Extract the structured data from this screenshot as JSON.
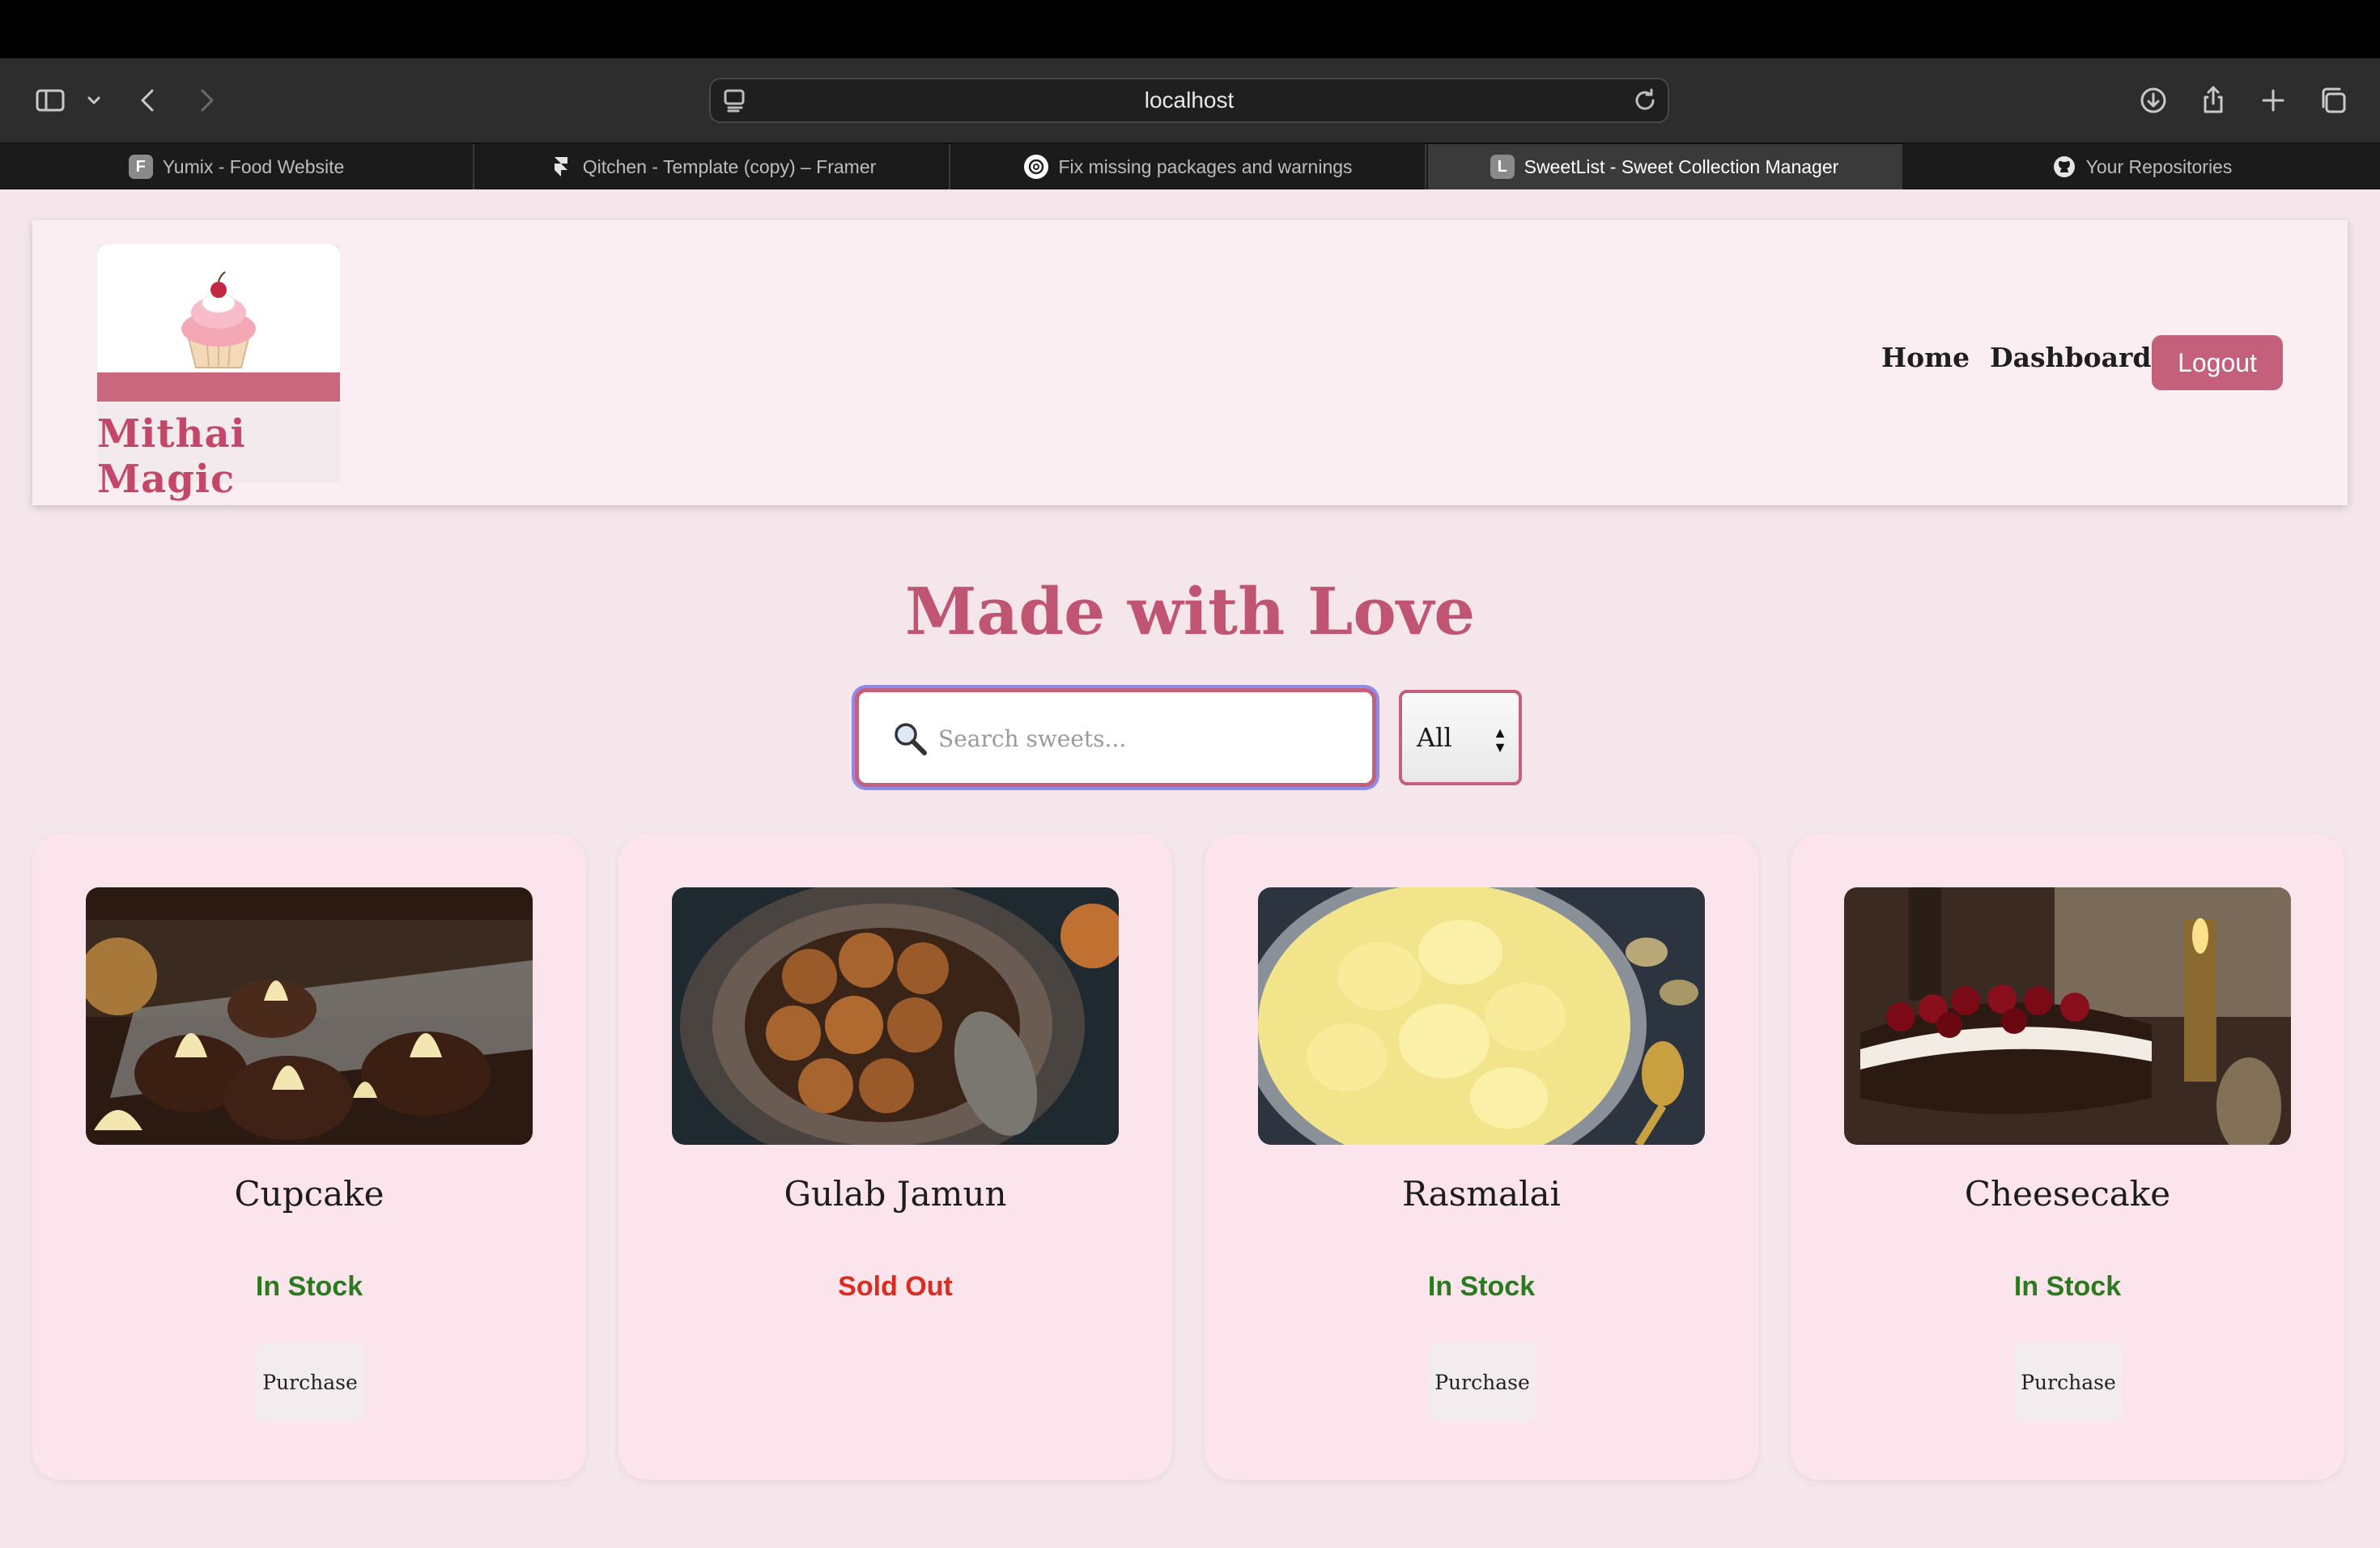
{
  "browser": {
    "url": "localhost",
    "tabs": [
      {
        "title": "Yumix - Food Website",
        "favicon": "F"
      },
      {
        "title": "Qitchen - Template (copy) – Framer",
        "favicon": "framer-icon"
      },
      {
        "title": "Fix missing packages and warnings",
        "favicon": "chatgpt-icon"
      },
      {
        "title": "SweetList - Sweet Collection Manager",
        "favicon": "L"
      },
      {
        "title": "Your Repositories",
        "favicon": "github-icon"
      }
    ],
    "active_tab": 3
  },
  "header": {
    "logo_text": "Mithai Magic",
    "nav": {
      "home": "Home",
      "dashboard": "Dashboard",
      "logout": "Logout"
    }
  },
  "hero": {
    "title": "Made with Love"
  },
  "search": {
    "placeholder": "Search sweets...",
    "filter_value": "All"
  },
  "sweets": [
    {
      "name": "Cupcake",
      "status": "In Stock",
      "button": "Purchase"
    },
    {
      "name": "Gulab Jamun",
      "status": "Sold Out",
      "button": ""
    },
    {
      "name": "Rasmalai",
      "status": "In Stock",
      "button": "Purchase"
    },
    {
      "name": "Cheesecake",
      "status": "In Stock",
      "button": "Purchase"
    }
  ],
  "colors": {
    "accent": "#c45f7c",
    "in_stock": "#2b7a1f",
    "sold_out": "#d92d1f",
    "card_bg": "#fbe4ec",
    "page_bg": "#f5e6ec"
  }
}
